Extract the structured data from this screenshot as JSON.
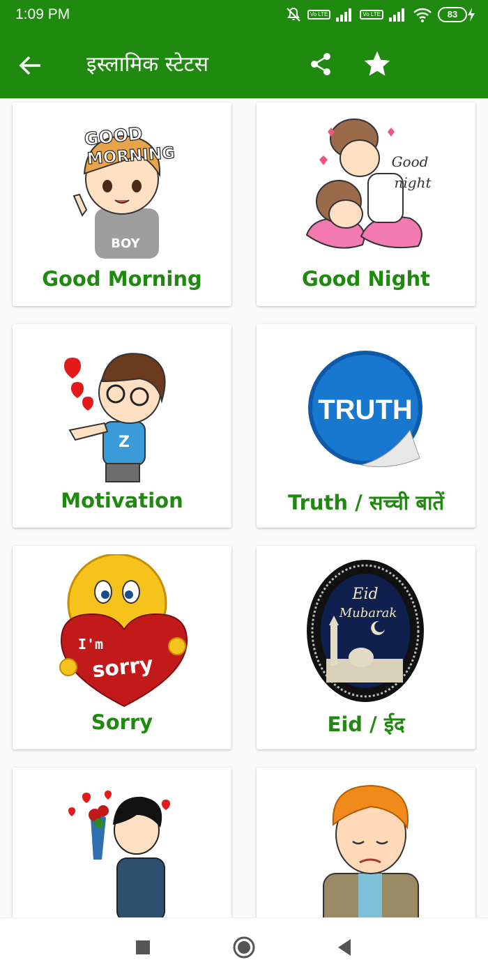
{
  "status_bar": {
    "time": "1:09 PM",
    "volte_1": "Vo LTE",
    "volte_2": "Vo LTE",
    "battery": "83"
  },
  "app_bar": {
    "title": "इस्लामिक स्टेटस",
    "back_icon": "arrow-left-icon",
    "share_icon": "share-icon",
    "favorite_icon": "star-icon"
  },
  "colors": {
    "primary": "#1f8a0f",
    "label": "#1f8a0f",
    "background": "#fafafa"
  },
  "categories": [
    {
      "label": "Good Morning",
      "art_text_1": "GOOD",
      "art_text_2": "MORNING",
      "art_text_3": "BOY"
    },
    {
      "label": "Good Night",
      "art_text_1": "Good",
      "art_text_2": "night"
    },
    {
      "label": "Motivation",
      "art_text_1": "Z"
    },
    {
      "label": "Truth / सच्ची बातें",
      "art_text_1": "TRUTH"
    },
    {
      "label": "Sorry",
      "art_text_1": "I'm",
      "art_text_2": "sorry"
    },
    {
      "label": "Eid / ईद",
      "art_text_1": "Eid",
      "art_text_2": "Mubarak"
    },
    {
      "label": ""
    },
    {
      "label": ""
    }
  ],
  "nav_bar": {
    "recents_icon": "square-icon",
    "home_icon": "circle-icon",
    "back_icon": "triangle-back-icon"
  }
}
